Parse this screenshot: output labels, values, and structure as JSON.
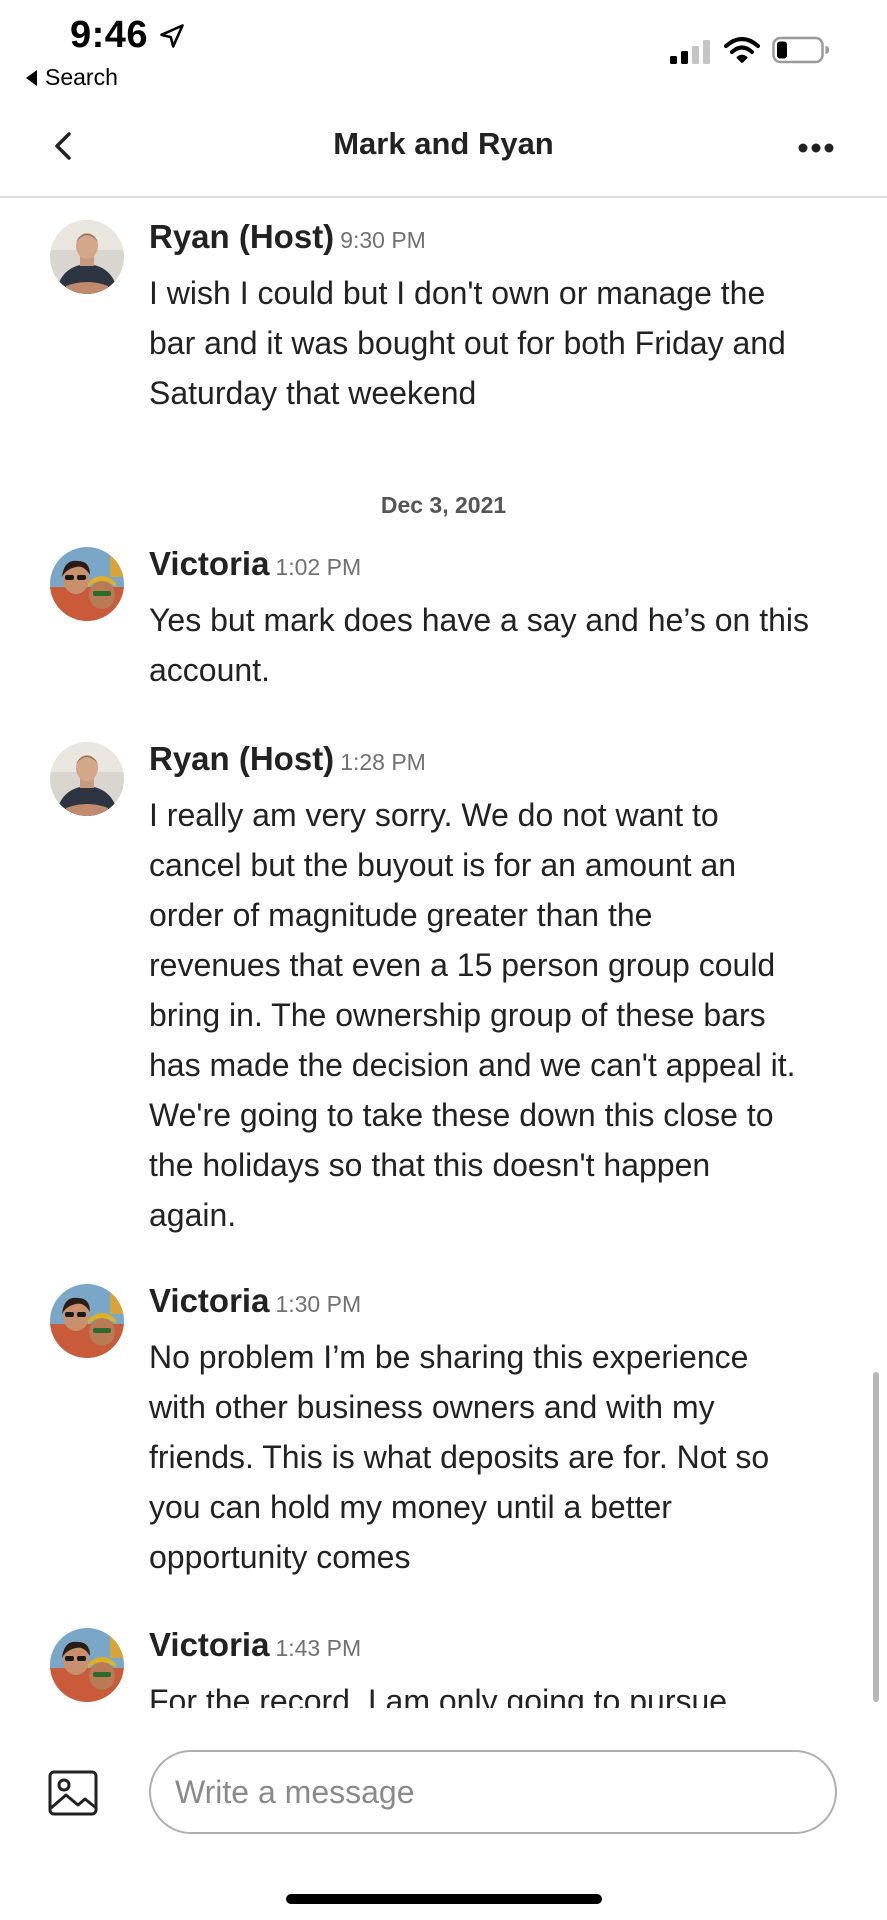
{
  "status_bar": {
    "time": "9:46",
    "back_label": "Search",
    "icons": [
      "location-arrow-icon",
      "signal-icon",
      "wifi-icon",
      "battery-icon"
    ]
  },
  "header": {
    "title": "Mark and Ryan",
    "back_icon": "chevron-left-icon",
    "more_icon": "more-dots-icon"
  },
  "messages": [
    {
      "sender": "Ryan (Host)",
      "time": "9:30 PM",
      "lines": [
        "I wish I could but I don't own or manage the",
        "bar and it was bought out for both Friday and",
        "Saturday that weekend"
      ]
    },
    {
      "date_separator": "Dec 3, 2021"
    },
    {
      "sender": "Victoria",
      "time": "1:02 PM",
      "lines": [
        "Yes but mark does have a say and he’s on this",
        "account."
      ]
    },
    {
      "sender": "Ryan (Host)",
      "time": "1:28 PM",
      "lines": [
        "I really am very sorry. We do not want to",
        "cancel but the buyout is for an amount an",
        "order of magnitude greater than the",
        "revenues that even a 15 person group could",
        "bring in. The ownership group of these bars",
        "has made the decision and we can't appeal it.",
        "We're going to take these down this close to",
        "the holidays so that this doesn't happen",
        "again."
      ]
    },
    {
      "sender": "Victoria",
      "time": "1:30 PM",
      "lines": [
        "No problem I’m be sharing this experience",
        "with other business owners and with my",
        "friends. This is what deposits are for. Not so",
        "you can hold my money until a better",
        "opportunity comes"
      ]
    },
    {
      "sender": "Victoria",
      "time": "1:43 PM",
      "lines": [
        "For the record, I am only going to pursue"
      ]
    }
  ],
  "composer": {
    "placeholder": "Write a message",
    "photo_icon": "image-icon"
  }
}
